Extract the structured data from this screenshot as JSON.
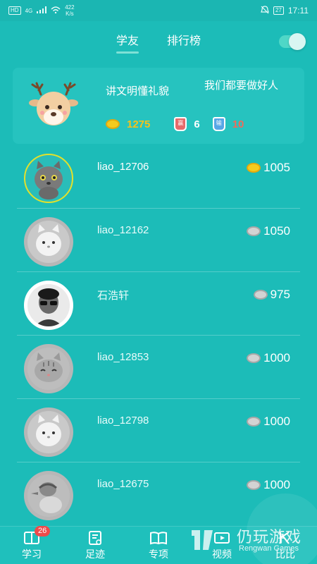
{
  "status_bar": {
    "hd": "HD",
    "network": "4G",
    "speed_value": "422",
    "speed_unit": "K/s",
    "battery": "27",
    "time": "17:11"
  },
  "top_nav": {
    "tabs": [
      {
        "label": "学友",
        "active": true
      },
      {
        "label": "排行榜",
        "active": false
      }
    ]
  },
  "profile": {
    "name": "讲文明懂礼貌",
    "motto": "我们都要做好人",
    "gold": "1275",
    "win_badge": "赢",
    "wins": "6",
    "lose_badge": "输",
    "losses": "10"
  },
  "friends": [
    {
      "name": "liao_12706",
      "score": "1005",
      "coin": "gold",
      "avatar": "gray-cat-icon"
    },
    {
      "name": "liao_12162",
      "score": "1050",
      "coin": "silver",
      "avatar": "white-cat-icon"
    },
    {
      "name": "石浩轩",
      "score": "975",
      "coin": "silver",
      "avatar": "person-photo-icon"
    },
    {
      "name": "liao_12853",
      "score": "1000",
      "coin": "silver",
      "avatar": "tabby-cat-icon"
    },
    {
      "name": "liao_12798",
      "score": "1000",
      "coin": "silver",
      "avatar": "white-cat-icon"
    },
    {
      "name": "liao_12675",
      "score": "1000",
      "coin": "silver",
      "avatar": "duck-icon"
    }
  ],
  "bottom_nav": {
    "items": [
      {
        "label": "学习",
        "badge": "26",
        "icon": "book-icon"
      },
      {
        "label": "足迹",
        "icon": "footprint-icon"
      },
      {
        "label": "专项",
        "icon": "open-book-icon"
      },
      {
        "label": "视频",
        "icon": "video-icon"
      },
      {
        "label": "比比",
        "icon": "vs-icon"
      }
    ]
  },
  "watermark": {
    "title": "仍玩游戏",
    "subtitle": "Rengwan Games"
  },
  "colors": {
    "background": "#1cbcb8",
    "gold": "#f6c21a",
    "loss": "#f06a5a"
  }
}
